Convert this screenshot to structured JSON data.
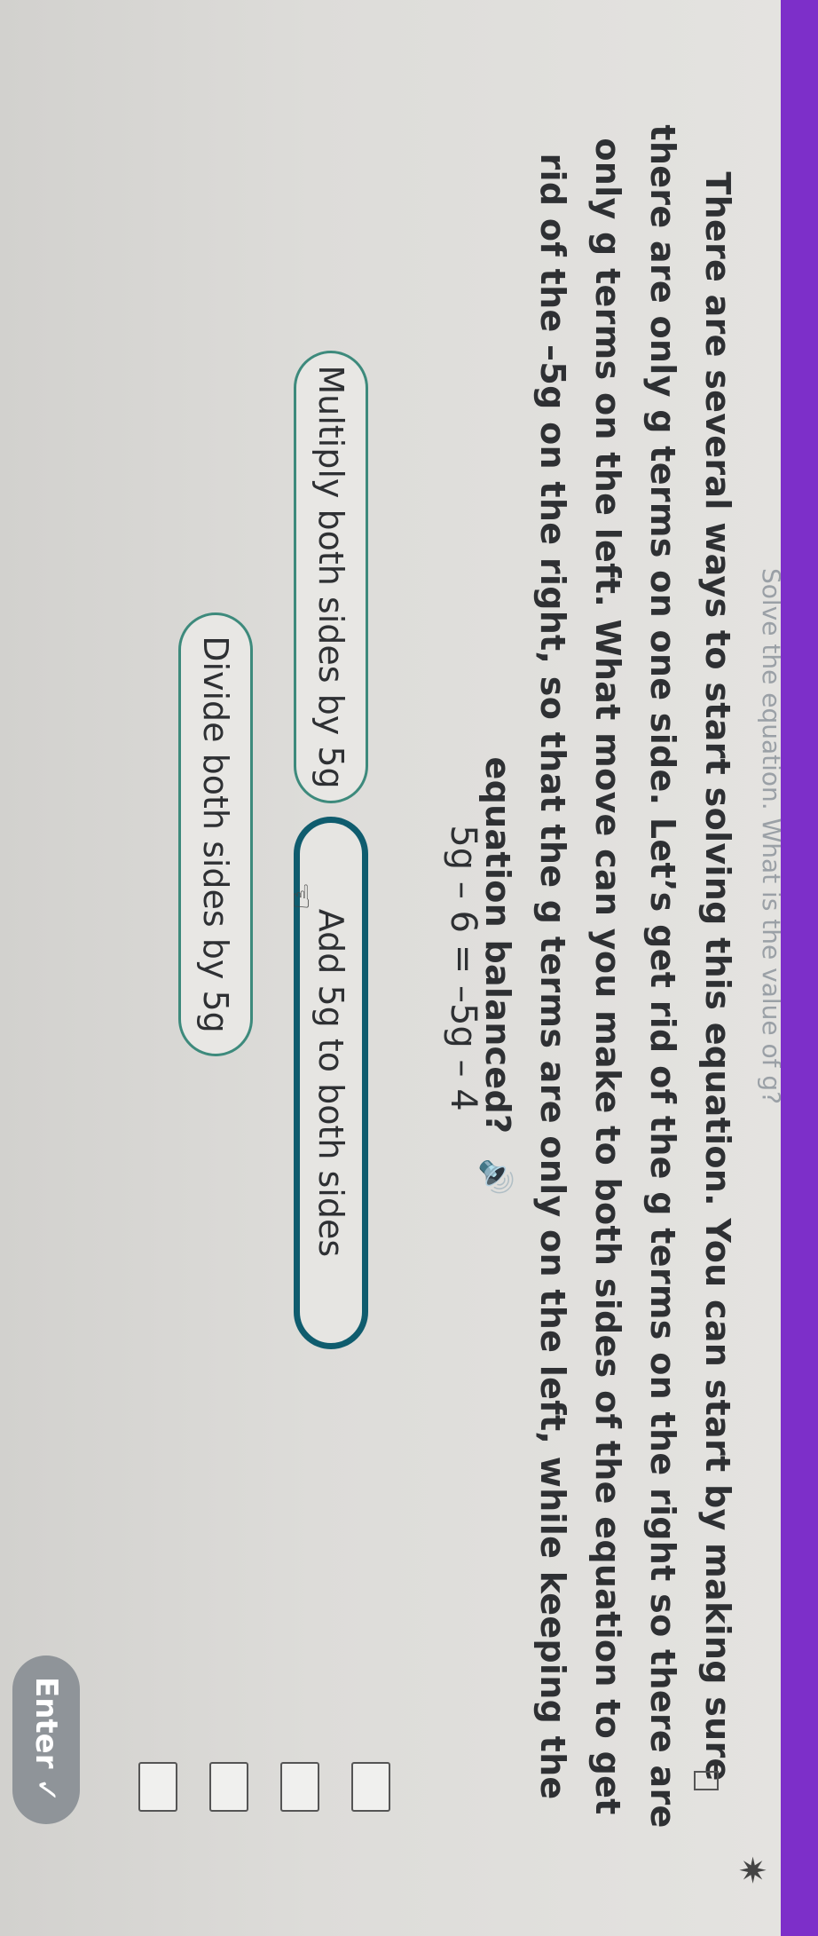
{
  "header": {
    "title_fragment": "Solve the equation. What is the value of g?"
  },
  "instruction": {
    "text": "There are several ways to start solving this equation. You can start by making sure there are only g terms on one side. Let’s get rid of the g terms on the right so there are only g terms on the left. What move can you make to both sides of the equation to get rid of the –5g on the right, so that the g terms are only on the left, while keeping the equation balanced?",
    "audio_icon": "speaker-icon"
  },
  "equation": {
    "text": "5g – 6 = –5g – 4"
  },
  "choices": [
    {
      "label": "Multiply both sides by 5g",
      "selected": false
    },
    {
      "label": "Add 5g to both sides",
      "selected": true
    },
    {
      "label": "Divide both sides by 5g",
      "selected": false
    }
  ],
  "enter_button": {
    "label": "Enter",
    "icon": "check-icon"
  },
  "progress": {
    "icon": "sparkle-icon"
  },
  "colors": {
    "accent": "#7d2fc9",
    "selected_border": "#0f5c6e",
    "choice_border": "#3d8a7c",
    "enter_bg": "#8f9499"
  }
}
